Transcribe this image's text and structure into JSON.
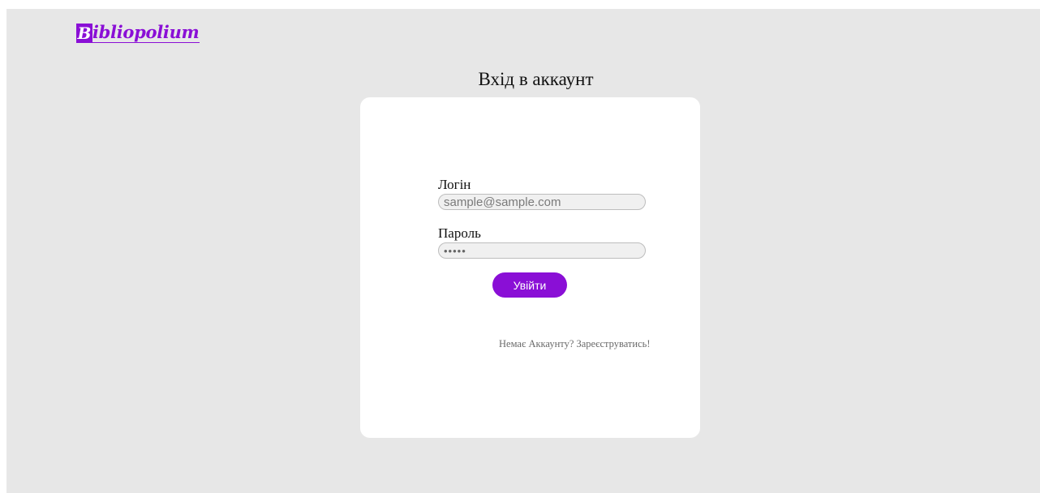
{
  "header": {
    "logo_initial": "B",
    "logo_rest": "ibliopolium"
  },
  "page": {
    "title": "Вхід в аккаунт"
  },
  "login_form": {
    "login_label": "Логін",
    "login_placeholder": "sample@sample.com",
    "login_value": "",
    "password_label": "Пароль",
    "password_value": "•••••",
    "submit_label": "Увійти",
    "register_link": "Немає Аккаунту? Зареєструватись!"
  },
  "colors": {
    "brand": "#8a0fd6",
    "page_background": "#e7e7e7",
    "card_background": "#ffffff"
  }
}
